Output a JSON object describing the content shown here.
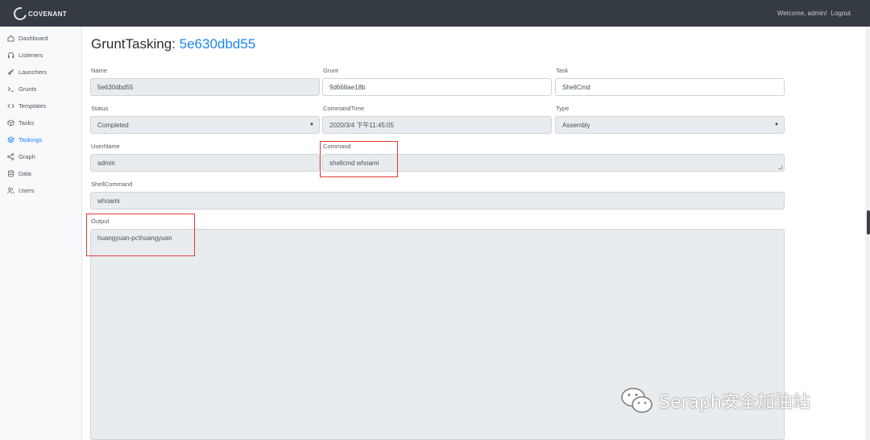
{
  "brand": {
    "name": "COVENANT"
  },
  "header": {
    "welcome": "Welcome, admin!",
    "logout": "Logout"
  },
  "sidebar": {
    "items": [
      {
        "label": "Dashboard",
        "icon": "dashboard-icon"
      },
      {
        "label": "Listeners",
        "icon": "headphones-icon"
      },
      {
        "label": "Launchers",
        "icon": "rocket-icon"
      },
      {
        "label": "Grunts",
        "icon": "terminal-icon"
      },
      {
        "label": "Templates",
        "icon": "code-icon"
      },
      {
        "label": "Tasks",
        "icon": "box-icon"
      },
      {
        "label": "Taskings",
        "icon": "layers-icon",
        "active": true
      },
      {
        "label": "Graph",
        "icon": "share-icon"
      },
      {
        "label": "Data",
        "icon": "database-icon"
      },
      {
        "label": "Users",
        "icon": "users-icon"
      }
    ]
  },
  "page": {
    "title": "GruntTasking:",
    "id": "5e630dbd55"
  },
  "form": {
    "name": {
      "label": "Name",
      "value": "5e630dbd55"
    },
    "grunt": {
      "label": "Grunt",
      "value": "9d668ae18b"
    },
    "task": {
      "label": "Task",
      "value": "ShellCmd"
    },
    "status": {
      "label": "Status",
      "value": "Completed"
    },
    "command_time": {
      "label": "CommandTime",
      "value": "2020/3/4 下午11:45:05"
    },
    "type": {
      "label": "Type",
      "value": "Assembly"
    },
    "username": {
      "label": "UserName",
      "value": "admin"
    },
    "command": {
      "label": "Command",
      "value": "shellcmd whoami"
    },
    "shell_command": {
      "label": "ShellCommand",
      "value": "whoami"
    },
    "output": {
      "label": "Output",
      "value": "huangyuan-pc\\huangyuan"
    }
  },
  "watermark": {
    "text": "Seraph安全加油站"
  },
  "colors": {
    "accent": "#1e87f0",
    "topbar": "#353b43",
    "highlight": "#e53935"
  }
}
